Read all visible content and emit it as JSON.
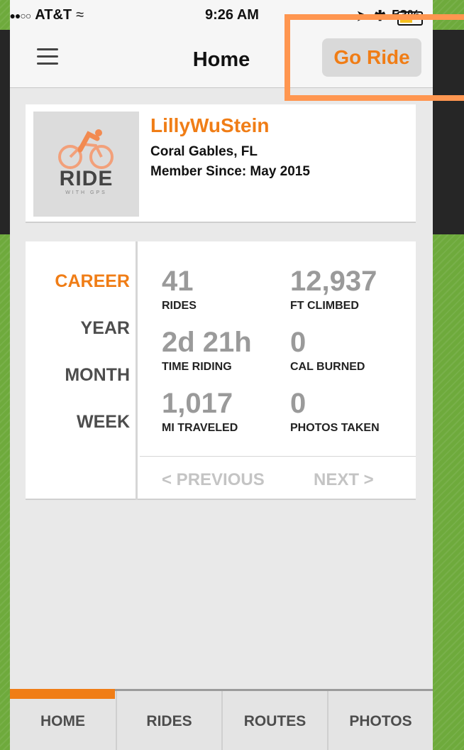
{
  "status_bar": {
    "carrier": "AT&T",
    "time": "9:26 AM",
    "battery": "53%",
    "battery_level": 0.53
  },
  "nav": {
    "title": "Home",
    "go_ride_label": "Go Ride",
    "menu_icon": "hamburger-menu-icon"
  },
  "profile": {
    "username": "LillyWuStein",
    "location": "Coral Gables, FL",
    "member_since": "Member Since: May 2015",
    "logo_word": "RIDE",
    "logo_sub": "WITH GPS"
  },
  "stats": {
    "periods": [
      "CAREER",
      "YEAR",
      "MONTH",
      "WEEK"
    ],
    "active_period": "CAREER",
    "items": [
      {
        "value": "41",
        "label": "RIDES"
      },
      {
        "value": "12,937",
        "label": "FT CLIMBED"
      },
      {
        "value": "2d 21h",
        "label": "TIME RIDING"
      },
      {
        "value": "0",
        "label": "CAL BURNED"
      },
      {
        "value": "1,017",
        "label": "MI TRAVELED"
      },
      {
        "value": "0",
        "label": "PHOTOS TAKEN"
      }
    ],
    "previous_label": "< PREVIOUS",
    "next_label": "NEXT >"
  },
  "tabs": [
    {
      "label": "HOME"
    },
    {
      "label": "RIDES"
    },
    {
      "label": "ROUTES"
    },
    {
      "label": "PHOTOS"
    }
  ],
  "active_tab": "HOME",
  "colors": {
    "accent": "#f07d16",
    "highlight_box": "#ff9650",
    "background_green": "#6eaa3c"
  }
}
